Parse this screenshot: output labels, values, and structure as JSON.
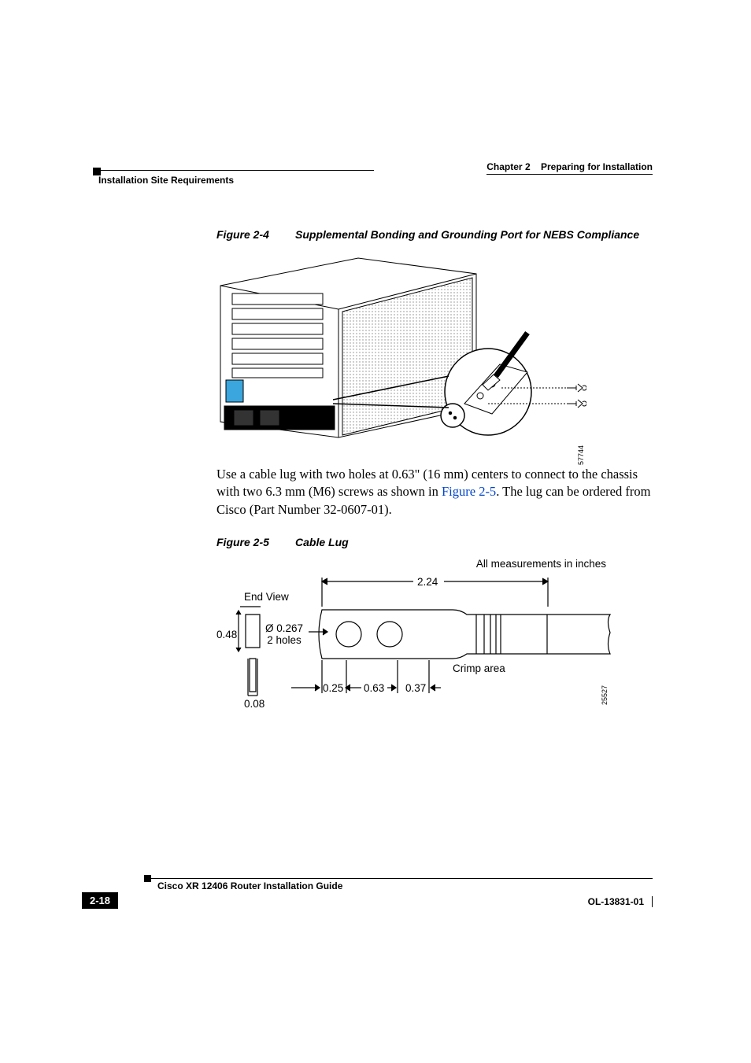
{
  "header": {
    "chapter_prefix": "Chapter 2",
    "chapter_title": "Preparing for Installation",
    "section": "Installation Site Requirements"
  },
  "figure4": {
    "number": "Figure 2-4",
    "title": "Supplemental Bonding and Grounding Port for NEBS Compliance",
    "image_id": "57744"
  },
  "paragraph": {
    "part1": "Use a cable lug with two holes at 0.63\" (16 mm) centers to connect to the chassis with two 6.3 mm (M6) screws as shown in ",
    "xref": "Figure 2-5",
    "part2": ". The lug can be ordered from Cisco (Part Number 32-0607-01)."
  },
  "figure5": {
    "number": "Figure 2-5",
    "title": "Cable Lug",
    "labels": {
      "units": "All measurements in inches",
      "end_view": "End View",
      "dim_048": "0.48",
      "dim_008": "0.08",
      "holes_spec": "Ø 0.267\n2 holes",
      "dim_224": "2.24",
      "dim_025": "0.25",
      "dim_063": "0.63",
      "dim_037": "0.37",
      "crimp": "Crimp area"
    },
    "image_id": "25527"
  },
  "footer": {
    "guide_title": "Cisco XR 12406 Router Installation Guide",
    "page_num": "2-18",
    "ol_num": "OL-13831-01"
  }
}
